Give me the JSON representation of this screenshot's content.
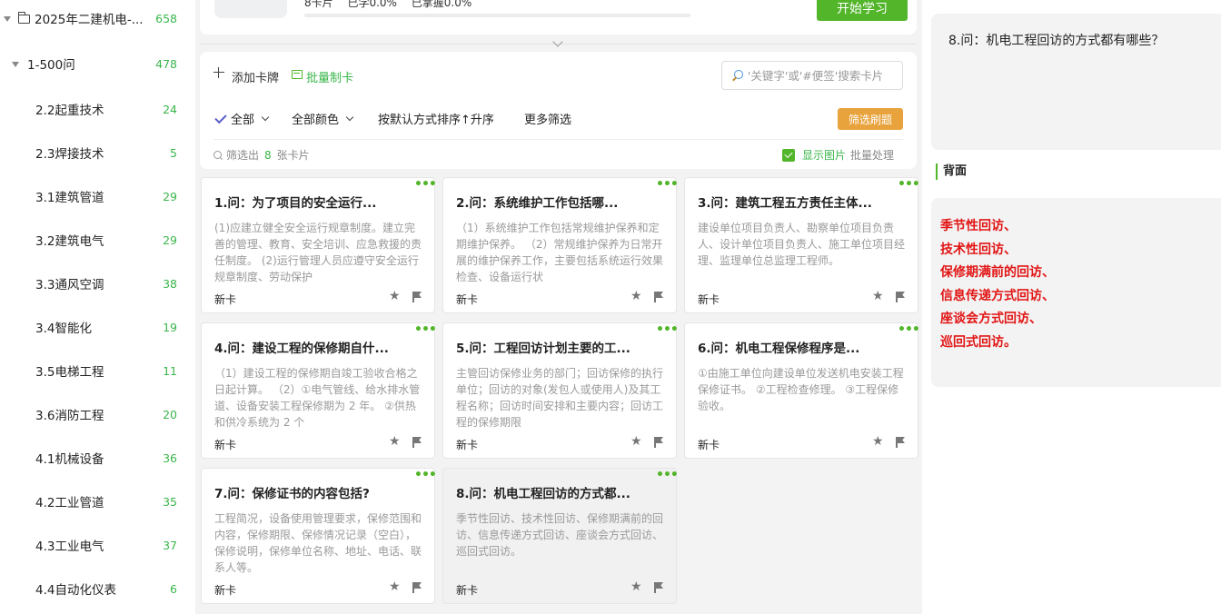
{
  "sidebar": {
    "items": [
      {
        "label": "2025年二建机电-...",
        "count": "658",
        "level": 0
      },
      {
        "label": "1-500问",
        "count": "478",
        "level": 1
      },
      {
        "label": "2.2起重技术",
        "count": "24",
        "level": 2
      },
      {
        "label": "2.3焊接技术",
        "count": "5",
        "level": 2
      },
      {
        "label": "3.1建筑管道",
        "count": "29",
        "level": 2
      },
      {
        "label": "3.2建筑电气",
        "count": "29",
        "level": 2
      },
      {
        "label": "3.3通风空调",
        "count": "38",
        "level": 2
      },
      {
        "label": "3.4智能化",
        "count": "19",
        "level": 2
      },
      {
        "label": "3.5电梯工程",
        "count": "11",
        "level": 2
      },
      {
        "label": "3.6消防工程",
        "count": "20",
        "level": 2
      },
      {
        "label": "4.1机械设备",
        "count": "36",
        "level": 2
      },
      {
        "label": "4.2工业管道",
        "count": "35",
        "level": 2
      },
      {
        "label": "4.3工业电气",
        "count": "37",
        "level": 2
      },
      {
        "label": "4.4自动化仪表",
        "count": "6",
        "level": 2
      }
    ]
  },
  "deck": {
    "card_count": "8卡片",
    "learned": "已学0.0%",
    "mastered": "已掌握0.0%",
    "progress": 0,
    "start_label": "开始学习"
  },
  "toolbar": {
    "add_card": "添加卡牌",
    "batch_create": "批量制卡",
    "search_placeholder": "'关键字'或'#便签'搜索卡片",
    "filter_all": "全部",
    "filter_color": "全部颜色",
    "sort": "按默认方式排序↑升序",
    "more_filters": "更多筛选",
    "quiz_button": "筛选刷题",
    "filtered_prefix": "筛选出",
    "filtered_count": "8",
    "filtered_suffix": "张卡片",
    "show_images": "显示图片",
    "batch_process": "批量处理"
  },
  "cards": [
    {
      "title": "1.问：为了项目的安全运行...",
      "body": "(1)应建立健全安全运行规章制度。建立完善的管理、教育、安全培训、应急救援的责任制度。 (2)运行管理人员应遵守安全运行规章制度、劳动保护",
      "tag": "新卡"
    },
    {
      "title": "2.问：系统维护工作包括哪...",
      "body": "（1）系统维护工作包括常规维护保养和定期维护保养。 （2）常规维护保养为日常开展的维护保养工作，主要包括系统运行效果检查、设备运行状",
      "tag": "新卡"
    },
    {
      "title": "3.问：建筑工程五方责任主体...",
      "body": "建设单位项目负责人、勘察单位项目负责人、设计单位项目负责人、施工单位项目经理、监理单位总监理工程师。",
      "tag": "新卡"
    },
    {
      "title": "4.问：建设工程的保修期自什...",
      "body": "（1）建设工程的保修期自竣工验收合格之日起计算。 （2）①电气管线、给水排水管道、设备安装工程保修期为 2 年。 ②供热和供冷系统为 2 个",
      "tag": "新卡"
    },
    {
      "title": "5.问：工程回访计划主要的工...",
      "body": "主管回访保修业务的部门；回访保修的执行单位；回访的对象(发包人或使用人)及其工程名称；回访时间安排和主要内容；回访工程的保修期限",
      "tag": "新卡"
    },
    {
      "title": "6.问：机电工程保修程序是...",
      "body": "①由施工单位向建设单位发送机电安装工程保修证书。 ②工程检查修理。 ③工程保修验收。",
      "tag": "新卡"
    },
    {
      "title": "7.问：保修证书的内容包括?",
      "body": "工程简况，设备使用管理要求，保修范围和内容，保修期限、保修情况记录（空白），保修说明，保修单位名称、地址、电话、联系人等。",
      "tag": "新卡"
    },
    {
      "title": "8.问：机电工程回访的方式都...",
      "body": "季节性回访、技术性回访、保修期满前的回访、信息传递方式回访、座谈会方式回访、 巡回式回访。",
      "tag": "新卡"
    }
  ],
  "detail": {
    "question": "8.问：机电工程回访的方式都有哪些？",
    "back_label": "背面",
    "answer_lines": [
      "季节性回访、",
      "技术性回访、",
      "保修期满前的回访、",
      "信息传递方式回访、",
      "座谈会方式回访、",
      "巡回式回访。"
    ]
  },
  "colors": {
    "accent_green": "#52b52a",
    "quiz_orange": "#e8a33d",
    "answer_red": "#e21515"
  }
}
